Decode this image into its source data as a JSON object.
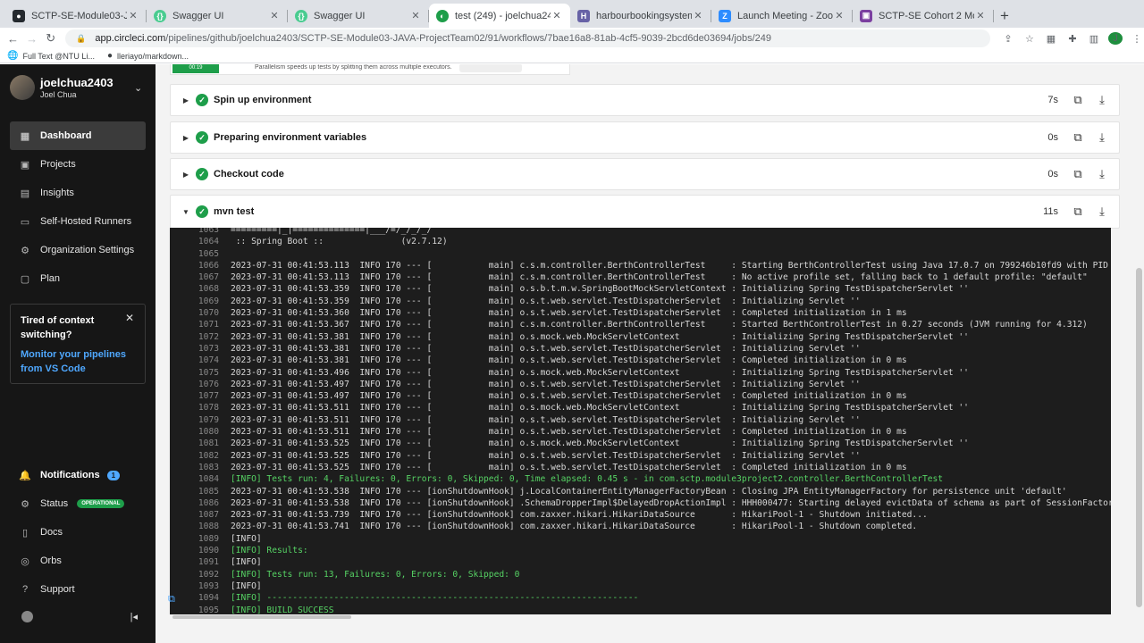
{
  "browser": {
    "tabs": [
      {
        "title": "SCTP-SE-Module03-JAVA-Proj",
        "icon": "github-icon",
        "active": false
      },
      {
        "title": "Swagger UI",
        "icon": "swagger-icon",
        "active": false
      },
      {
        "title": "Swagger UI",
        "icon": "swagger-icon",
        "active": false
      },
      {
        "title": "test (249) - joelchua2403/SCT",
        "icon": "circleci-icon",
        "active": true
      },
      {
        "title": "harbourbookingsystem | Herok",
        "icon": "heroku-icon",
        "active": false
      },
      {
        "title": "Launch Meeting - Zoom",
        "icon": "zoom-icon",
        "active": false
      },
      {
        "title": "SCTP-SE Cohort 2 Module 4 S",
        "icon": "slides-icon",
        "active": false
      }
    ],
    "url_domain": "app.circleci.com",
    "url_path": "/pipelines/github/joelchua2403/SCTP-SE-Module03-JAVA-ProjectTeam02/91/workflows/7bae16a8-81ab-4cf5-9039-2bcd6de03694/jobs/249",
    "profile_initial": "J",
    "bookmarks": [
      "Full Text @NTU Li...",
      "lleriayo/markdown..."
    ]
  },
  "sidebar": {
    "username": "joelchua2403",
    "fullname": "Joel Chua",
    "items": [
      {
        "label": "Dashboard",
        "icon": "dashboard-icon",
        "active": true
      },
      {
        "label": "Projects",
        "icon": "projects-icon"
      },
      {
        "label": "Insights",
        "icon": "insights-icon"
      },
      {
        "label": "Self-Hosted Runners",
        "icon": "runners-icon"
      },
      {
        "label": "Organization Settings",
        "icon": "gear-icon"
      },
      {
        "label": "Plan",
        "icon": "plan-icon"
      }
    ],
    "promo": {
      "title": "Tired of context switching?",
      "link": "Monitor your pipelines from VS Code"
    },
    "bottom_items": [
      {
        "label": "Notifications",
        "icon": "bell-icon",
        "badge": "1"
      },
      {
        "label": "Status",
        "icon": "status-icon",
        "badge": "OPERATIONAL"
      },
      {
        "label": "Docs",
        "icon": "docs-icon"
      },
      {
        "label": "Orbs",
        "icon": "orbs-icon"
      },
      {
        "label": "Support",
        "icon": "help-icon"
      }
    ]
  },
  "job": {
    "parallelism_note": "Parallelism speeds up tests by splitting them across multiple executors.",
    "duration_badge": "00:19",
    "steps": [
      {
        "name": "Spin up environment",
        "time": "7s",
        "expanded": false
      },
      {
        "name": "Preparing environment variables",
        "time": "0s",
        "expanded": false
      },
      {
        "name": "Checkout code",
        "time": "0s",
        "expanded": false
      },
      {
        "name": "mvn test",
        "time": "11s",
        "expanded": true
      }
    ],
    "log": [
      {
        "n": "1063",
        "t": "=========|_|==============|___/=/_/_/_/"
      },
      {
        "n": "1064",
        "t": " :: Spring Boot ::               (v2.7.12)"
      },
      {
        "n": "1065",
        "t": ""
      },
      {
        "n": "1066",
        "t": "2023-07-31 00:41:53.113  INFO 170 --- [           main] c.s.m.controller.BerthControllerTest     : Starting BerthControllerTest using Java 17.0.7 on 799246b10fd9 with PID 170 ("
      },
      {
        "n": "1067",
        "t": "2023-07-31 00:41:53.113  INFO 170 --- [           main] c.s.m.controller.BerthControllerTest     : No active profile set, falling back to 1 default profile: \"default\""
      },
      {
        "n": "1068",
        "t": "2023-07-31 00:41:53.359  INFO 170 --- [           main] o.s.b.t.m.w.SpringBootMockServletContext : Initializing Spring TestDispatcherServlet ''"
      },
      {
        "n": "1069",
        "t": "2023-07-31 00:41:53.359  INFO 170 --- [           main] o.s.t.web.servlet.TestDispatcherServlet  : Initializing Servlet ''"
      },
      {
        "n": "1070",
        "t": "2023-07-31 00:41:53.360  INFO 170 --- [           main] o.s.t.web.servlet.TestDispatcherServlet  : Completed initialization in 1 ms"
      },
      {
        "n": "1071",
        "t": "2023-07-31 00:41:53.367  INFO 170 --- [           main] c.s.m.controller.BerthControllerTest     : Started BerthControllerTest in 0.27 seconds (JVM running for 4.312)"
      },
      {
        "n": "1072",
        "t": "2023-07-31 00:41:53.381  INFO 170 --- [           main] o.s.mock.web.MockServletContext          : Initializing Spring TestDispatcherServlet ''"
      },
      {
        "n": "1073",
        "t": "2023-07-31 00:41:53.381  INFO 170 --- [           main] o.s.t.web.servlet.TestDispatcherServlet  : Initializing Servlet ''"
      },
      {
        "n": "1074",
        "t": "2023-07-31 00:41:53.381  INFO 170 --- [           main] o.s.t.web.servlet.TestDispatcherServlet  : Completed initialization in 0 ms"
      },
      {
        "n": "1075",
        "t": "2023-07-31 00:41:53.496  INFO 170 --- [           main] o.s.mock.web.MockServletContext          : Initializing Spring TestDispatcherServlet ''"
      },
      {
        "n": "1076",
        "t": "2023-07-31 00:41:53.497  INFO 170 --- [           main] o.s.t.web.servlet.TestDispatcherServlet  : Initializing Servlet ''"
      },
      {
        "n": "1077",
        "t": "2023-07-31 00:41:53.497  INFO 170 --- [           main] o.s.t.web.servlet.TestDispatcherServlet  : Completed initialization in 0 ms"
      },
      {
        "n": "1078",
        "t": "2023-07-31 00:41:53.511  INFO 170 --- [           main] o.s.mock.web.MockServletContext          : Initializing Spring TestDispatcherServlet ''"
      },
      {
        "n": "1079",
        "t": "2023-07-31 00:41:53.511  INFO 170 --- [           main] o.s.t.web.servlet.TestDispatcherServlet  : Initializing Servlet ''"
      },
      {
        "n": "1080",
        "t": "2023-07-31 00:41:53.511  INFO 170 --- [           main] o.s.t.web.servlet.TestDispatcherServlet  : Completed initialization in 0 ms"
      },
      {
        "n": "1081",
        "t": "2023-07-31 00:41:53.525  INFO 170 --- [           main] o.s.mock.web.MockServletContext          : Initializing Spring TestDispatcherServlet ''"
      },
      {
        "n": "1082",
        "t": "2023-07-31 00:41:53.525  INFO 170 --- [           main] o.s.t.web.servlet.TestDispatcherServlet  : Initializing Servlet ''"
      },
      {
        "n": "1083",
        "t": "2023-07-31 00:41:53.525  INFO 170 --- [           main] o.s.t.web.servlet.TestDispatcherServlet  : Completed initialization in 0 ms"
      },
      {
        "n": "1084",
        "t": "[INFO] Tests run: 4, Failures: 0, Errors: 0, Skipped: 0, Time elapsed: 0.45 s - in com.sctp.module3project2.controller.BerthControllerTest",
        "g": true
      },
      {
        "n": "1085",
        "t": "2023-07-31 00:41:53.538  INFO 170 --- [ionShutdownHook] j.LocalContainerEntityManagerFactoryBean : Closing JPA EntityManagerFactory for persistence unit 'default'"
      },
      {
        "n": "1086",
        "t": "2023-07-31 00:41:53.538  INFO 170 --- [ionShutdownHook] .SchemaDropperImpl$DelayedDropActionImpl : HHH000477: Starting delayed evictData of schema as part of SessionFactory shu"
      },
      {
        "n": "1087",
        "t": "2023-07-31 00:41:53.739  INFO 170 --- [ionShutdownHook] com.zaxxer.hikari.HikariDataSource       : HikariPool-1 - Shutdown initiated..."
      },
      {
        "n": "1088",
        "t": "2023-07-31 00:41:53.741  INFO 170 --- [ionShutdownHook] com.zaxxer.hikari.HikariDataSource       : HikariPool-1 - Shutdown completed."
      },
      {
        "n": "1089",
        "t": "[INFO]"
      },
      {
        "n": "1090",
        "t": "[INFO] Results:",
        "g": true
      },
      {
        "n": "1091",
        "t": "[INFO]"
      },
      {
        "n": "1092",
        "t": "[INFO] Tests run: 13, Failures: 0, Errors: 0, Skipped: 0",
        "g": true
      },
      {
        "n": "1093",
        "t": "[INFO]"
      },
      {
        "n": "1094",
        "t": "[INFO] ------------------------------------------------------------------------",
        "g": true
      },
      {
        "n": "1095",
        "t": "[INFO] BUILD SUCCESS",
        "g": true
      }
    ]
  }
}
